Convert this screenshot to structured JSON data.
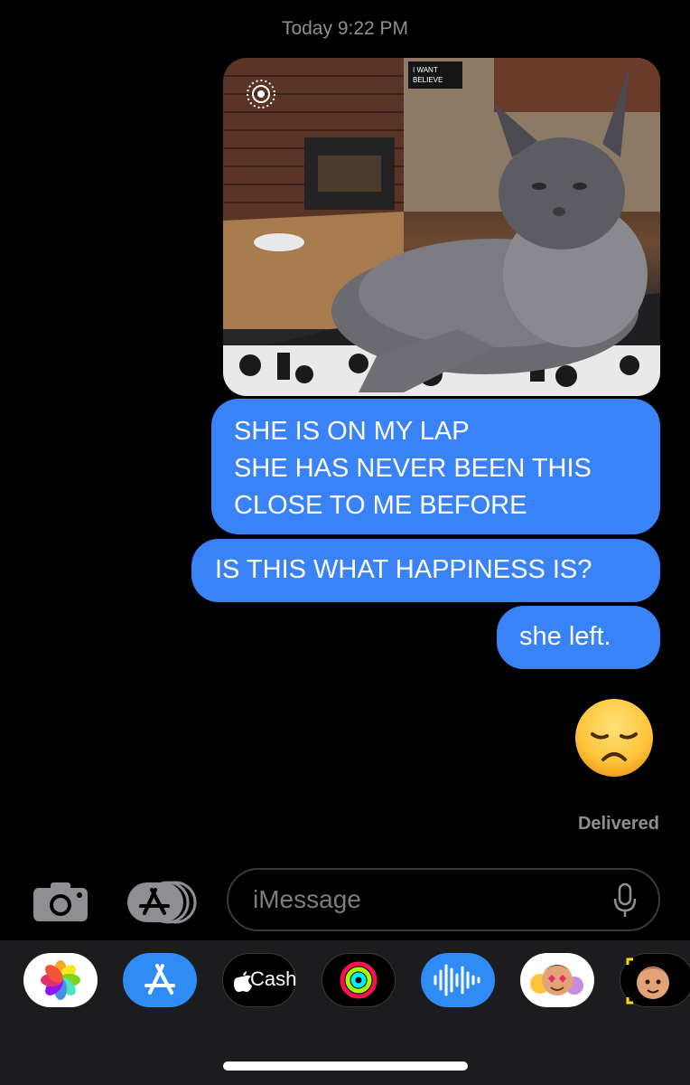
{
  "header": {
    "timestamp": "Today 9:22 PM"
  },
  "conversation": {
    "photo": {
      "alt": "Photo of a long-haired gray cat on a lap",
      "sign_text": "I WANT TO BELIEVE"
    },
    "messages": [
      {
        "lines": [
          "SHE IS ON MY LAP",
          "SHE HAS NEVER BEEN THIS",
          "CLOSE TO ME BEFORE"
        ]
      },
      {
        "text": "IS THIS WHAT HAPPINESS IS?"
      },
      {
        "text": "she left."
      }
    ],
    "emoji": "disappointed-face",
    "status": "Delivered"
  },
  "composer": {
    "placeholder": "iMessage",
    "camera_icon": "camera-icon",
    "apps_icon": "app-store-icon",
    "mic_icon": "microphone-icon"
  },
  "app_drawer": {
    "apps": [
      {
        "name": "Photos",
        "icon": "photos-icon"
      },
      {
        "name": "App Store",
        "icon": "app-store-icon"
      },
      {
        "name": "Apple Cash",
        "label": "Cash",
        "icon": "apple-cash-icon"
      },
      {
        "name": "Activity",
        "icon": "activity-rings-icon"
      },
      {
        "name": "Audio",
        "icon": "audio-waveform-icon"
      },
      {
        "name": "Memoji Stickers",
        "icon": "memoji-stickers-icon"
      },
      {
        "name": "Memoji",
        "icon": "memoji-icon"
      }
    ]
  },
  "colors": {
    "background": "#000000",
    "bubble": "#3a82f7",
    "secondary_text": "#8e8e93",
    "drawer": "#1c1c1e"
  }
}
